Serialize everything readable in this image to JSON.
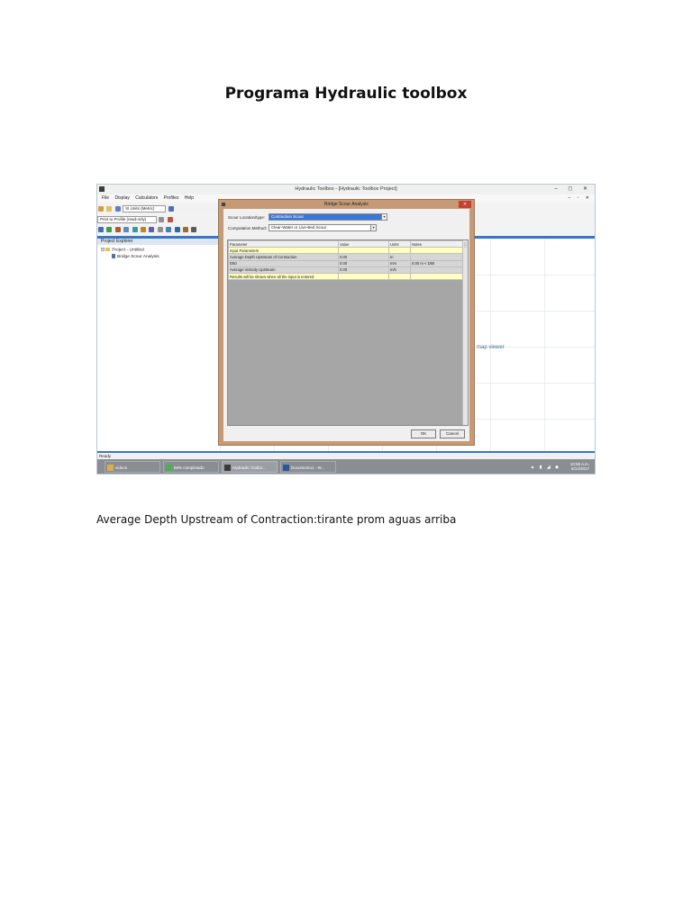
{
  "doc_title": "Programa Hydraulic toolbox",
  "caption": "Average Depth Upstream of Contraction:tirante prom aguas arriba",
  "screenshot": {
    "window_title": "Hydraulic Toolbox - [Hydraulic Toolbox Project]",
    "window_controls": "– ◻ ✕",
    "mdi_controls": "– ▫ ✕",
    "menu": [
      "File",
      "Display",
      "Calculators",
      "Profiles",
      "Help"
    ],
    "units_combo": "SI Units (Metric)",
    "profile_combo": "Print to Profile (read-only)",
    "explorer_title": "Project Explorer",
    "tree": {
      "project": "Project - Untitled",
      "child": "Bridge Scour Analysis"
    },
    "map_viewer": "map viewer",
    "status": "Ready",
    "taskbar": [
      {
        "label": "videos",
        "color": "#d8b04a"
      },
      {
        "label": "69% completado",
        "color": "#4caf50"
      },
      {
        "label": "Hydraulic Toolbo...",
        "color": "#3a3a3a"
      },
      {
        "label": "Documento1 - W...",
        "color": "#2b5797"
      }
    ],
    "tray_time": "10:58 a.m.",
    "tray_date": "6/14/2017",
    "dialog": {
      "title": "Bridge Scour Analysis",
      "close": "✕",
      "scour_label": "Scour Location/type:",
      "scour_value": "Contraction Scour",
      "method_label": "Computation Method:",
      "method_value": "Clear-Water or Live-Bed Scour",
      "columns": [
        "Parameter",
        "Value",
        "Units",
        "Notes"
      ],
      "section": "Input Parameters",
      "rows": [
        {
          "param": "Average Depth Upstream of Contraction",
          "value": "0.00",
          "units": "m",
          "notes": ""
        },
        {
          "param": "D50",
          "value": "0.00",
          "units": "mm",
          "notes": "0.00 m < D50"
        },
        {
          "param": "Average Velocity Upstream",
          "value": "0.00",
          "units": "m/s",
          "notes": ""
        }
      ],
      "results_note": "Results will be shown when all the input is entered",
      "ok": "OK",
      "cancel": "Cancel"
    }
  }
}
